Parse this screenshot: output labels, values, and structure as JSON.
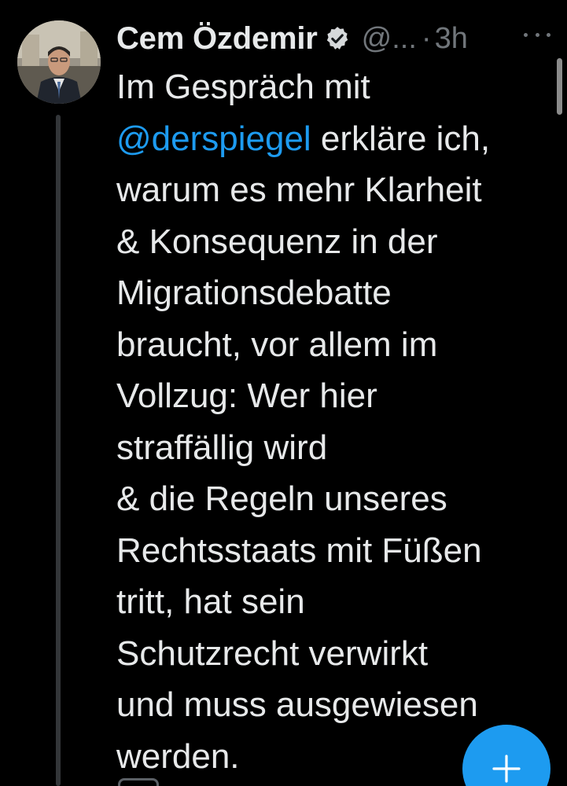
{
  "tweet": {
    "author": {
      "name": "Cem Özdemir",
      "handle": "@...",
      "verified": true,
      "avatar_icon": "profile-photo"
    },
    "separator": "·",
    "time": "3h",
    "text_lines": [
      "Im Gespräch mit",
      "@derspiegel",
      " erkläre ich,",
      "warum es mehr Klarheit",
      "& Konsequenz in der",
      "Migrationsdebatte",
      "braucht, vor allem im",
      "Vollzug: Wer hier",
      "straffällig wird",
      "& die Regeln unseres",
      "Rechtsstaats mit Füßen",
      "tritt, hat sein",
      "Schutzrecht verwirkt",
      "und muss ausgewiesen",
      "werden."
    ],
    "more_icon": "more-horizontal-icon"
  },
  "fab": {
    "icon": "plus-icon"
  },
  "colors": {
    "background": "#000000",
    "text": "#e7e9ea",
    "secondary": "#71767b",
    "accent": "#1d9bf0",
    "thread_line": "#333639"
  }
}
